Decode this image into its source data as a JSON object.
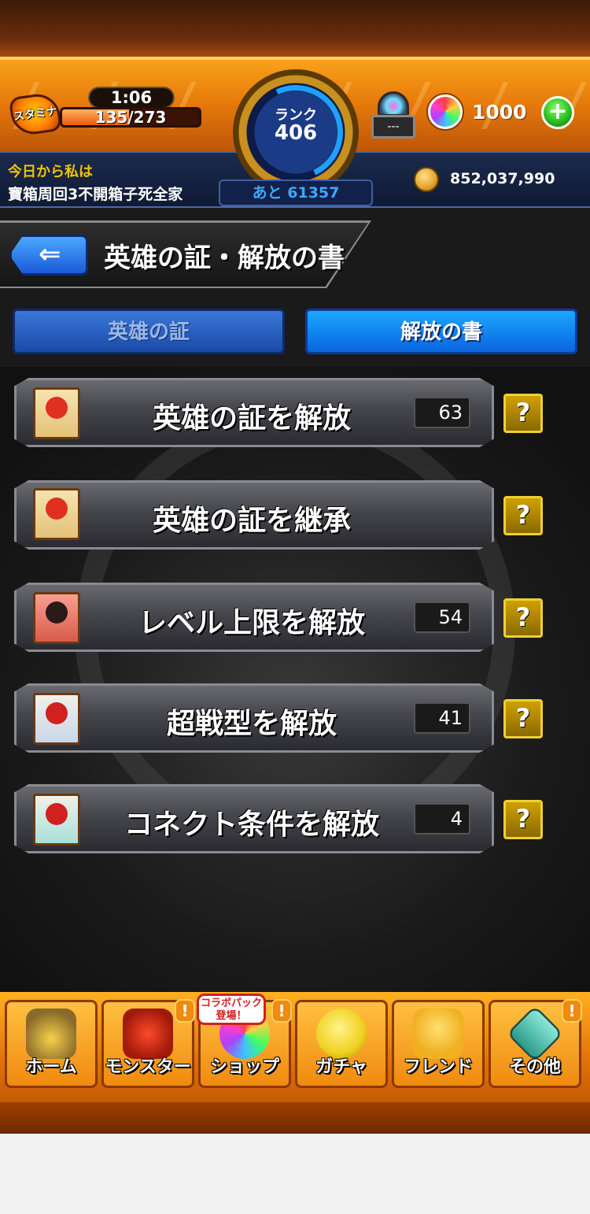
{
  "header": {
    "stamina_label": "スタミナ",
    "stamina_timer": "1:06",
    "stamina_value": "135/273",
    "stamina_fraction": 0.49,
    "rank_label": "ランク",
    "rank_value": "406",
    "exp_remaining": "あと 61357",
    "motto": "今日から私は",
    "nickname": "寶箱周回3不開箱子死全家",
    "ticket_count": "---",
    "orb_count": "1000",
    "orb_plus": "+",
    "coin_count": "852,037,990"
  },
  "title": {
    "back_icon": "⇐",
    "text": "英雄の証・解放の書"
  },
  "tabs": [
    {
      "label": "英雄の証",
      "active": false
    },
    {
      "label": "解放の書",
      "active": true
    }
  ],
  "rows": [
    {
      "label": "英雄の証を解放",
      "count": "63",
      "icon": "scroll-hero-icon",
      "help": "?"
    },
    {
      "label": "英雄の証を継承",
      "count": "",
      "icon": "scroll-inherit-icon",
      "help": "?"
    },
    {
      "label": "レベル上限を解放",
      "count": "54",
      "icon": "scroll-level-icon",
      "help": "?"
    },
    {
      "label": "超戦型を解放",
      "count": "41",
      "icon": "scroll-battle-icon",
      "help": "?"
    },
    {
      "label": "コネクト条件を解放",
      "count": "4",
      "icon": "scroll-connect-icon",
      "help": "?"
    }
  ],
  "nav": {
    "promo": "コラボパック 登場！",
    "badge": "!",
    "items": [
      {
        "label": "ホーム",
        "icon": "home-gate-icon"
      },
      {
        "label": "モンスター",
        "icon": "monster-icon"
      },
      {
        "label": "ショップ",
        "icon": "shop-orb-icon"
      },
      {
        "label": "ガチャ",
        "icon": "gacha-egg-icon"
      },
      {
        "label": "フレンド",
        "icon": "friend-icon"
      },
      {
        "label": "その他",
        "icon": "other-icon"
      }
    ]
  }
}
